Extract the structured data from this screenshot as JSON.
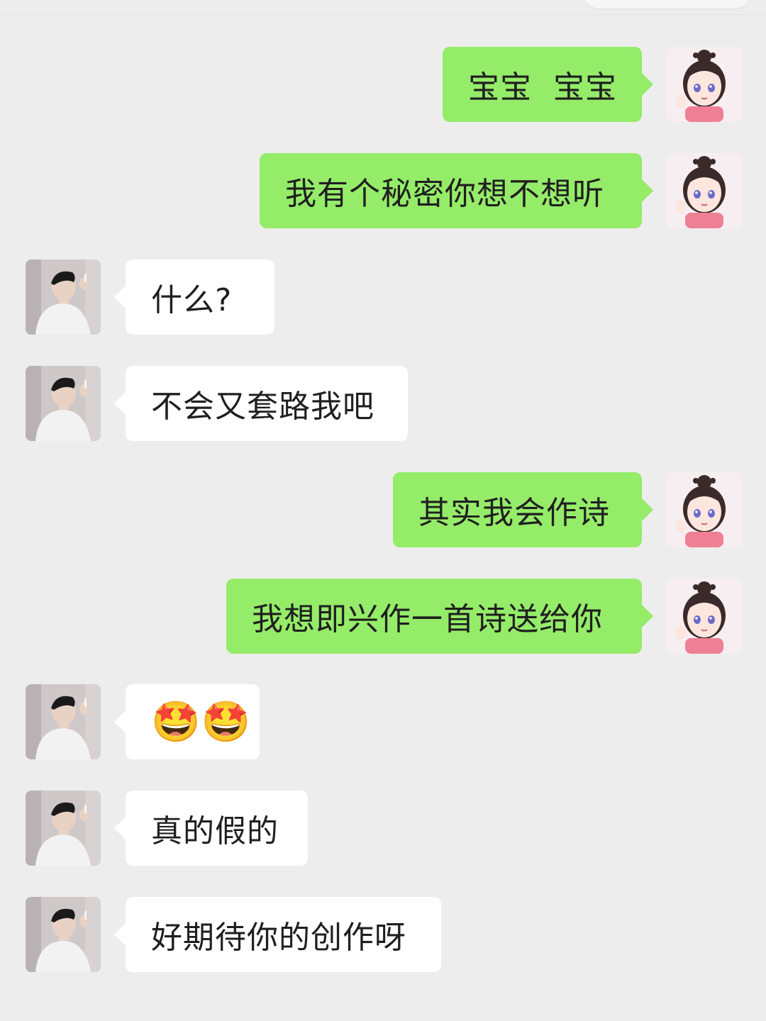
{
  "messages": [
    {
      "side": "sent",
      "text": "宝宝  宝宝",
      "avatar": "girl-cartoon-avatar"
    },
    {
      "side": "sent",
      "text": "我有个秘密你想不想听",
      "avatar": "girl-cartoon-avatar"
    },
    {
      "side": "received",
      "text": "什么?",
      "avatar": "boy-photo-avatar"
    },
    {
      "side": "received",
      "text": "不会又套路我吧",
      "avatar": "boy-photo-avatar"
    },
    {
      "side": "sent",
      "text": "其实我会作诗",
      "avatar": "girl-cartoon-avatar"
    },
    {
      "side": "sent",
      "text": "我想即兴作一首诗送给你",
      "avatar": "girl-cartoon-avatar"
    },
    {
      "side": "received",
      "text": "🤩🤩",
      "avatar": "boy-photo-avatar"
    },
    {
      "side": "received",
      "text": "真的假的",
      "avatar": "boy-photo-avatar"
    },
    {
      "side": "received",
      "text": "好期待你的创作呀",
      "avatar": "boy-photo-avatar"
    }
  ],
  "colors": {
    "background": "#ededed",
    "sent_bubble": "#95ec69",
    "received_bubble": "#ffffff",
    "text": "#1f1f1f"
  }
}
